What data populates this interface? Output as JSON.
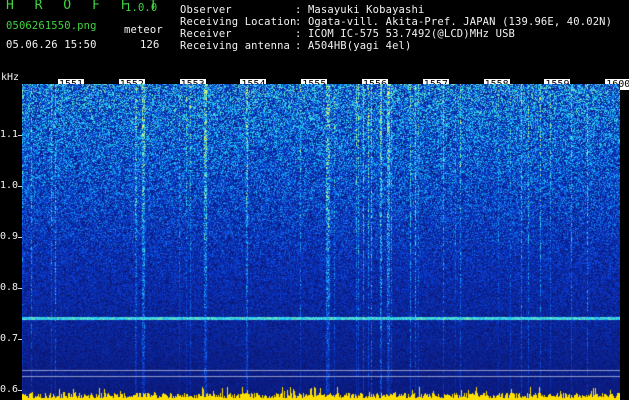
{
  "header": {
    "app_title": "H R O F F T",
    "version": "1.0.0",
    "file_name": "0506261550.png",
    "timestamp": "05.06.26 15:50",
    "meteor_label": "meteor",
    "meteor_count": "126"
  },
  "info": [
    {
      "key": "Observer",
      "value": ": Masayuki Kobayashi"
    },
    {
      "key": "Receiving Location",
      "value": ": Ogata-vill. Akita-Pref. JAPAN (139.96E, 40.02N)"
    },
    {
      "key": "Receiver",
      "value": ": ICOM IC-575 53.7492(@LCD)MHz USB"
    },
    {
      "key": "Receiving antenna",
      "value": ": A504HB(yagi 4el)"
    }
  ],
  "spectrogram": {
    "y_unit": "kHz",
    "y_ticks": [
      "1.1",
      "1.0",
      "0.9",
      "0.8",
      "0.7",
      "0.6"
    ],
    "y_range": [
      0.58,
      1.2
    ],
    "x_labels": [
      "1551",
      "1552",
      "1553",
      "1554",
      "1555",
      "1556",
      "1557",
      "1558",
      "1559",
      "1600"
    ],
    "colors": {
      "background": "#0a1470",
      "signal_line": "#4fd0ff",
      "marker": "#ffe000"
    }
  }
}
